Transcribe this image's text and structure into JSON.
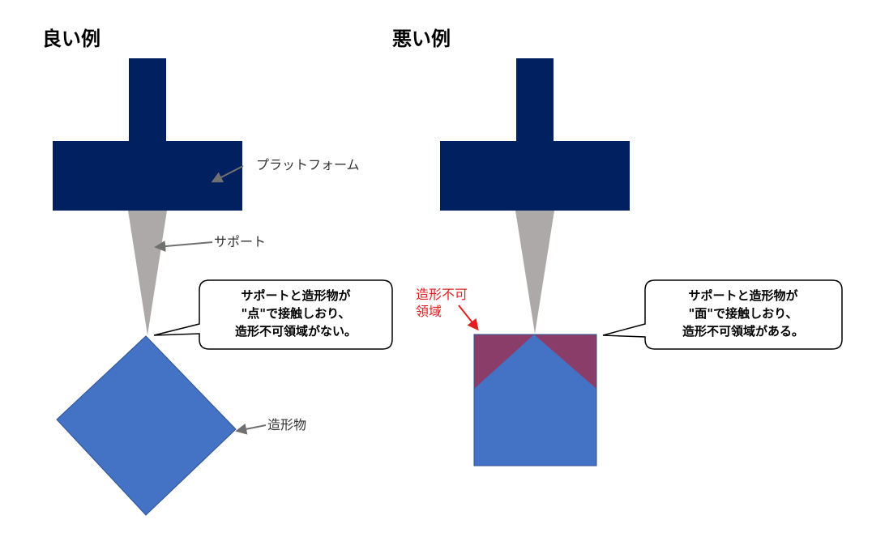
{
  "good": {
    "heading": "良い例",
    "platform_label": "プラットフォーム",
    "support_label": "サポート",
    "object_label": "造形物",
    "callout_lines": [
      "サポートと造形物が",
      "\"点\"で接触しおり、",
      "造形不可領域がない。"
    ]
  },
  "bad": {
    "heading": "悪い例",
    "unprintable_label_lines": [
      "造形不可",
      "領域"
    ],
    "callout_lines": [
      "サポートと造形物が",
      "\"面\"で接触しおり、",
      "造形不可領域がある。"
    ]
  },
  "colors": {
    "platform": "#002060",
    "support": "#ada9a9",
    "object": "#4472c4",
    "unprintable_region": "#8b3d6a",
    "unprintable_label": "#e02020",
    "pointer_arrow": "#707070",
    "callout_border": "#000000"
  }
}
